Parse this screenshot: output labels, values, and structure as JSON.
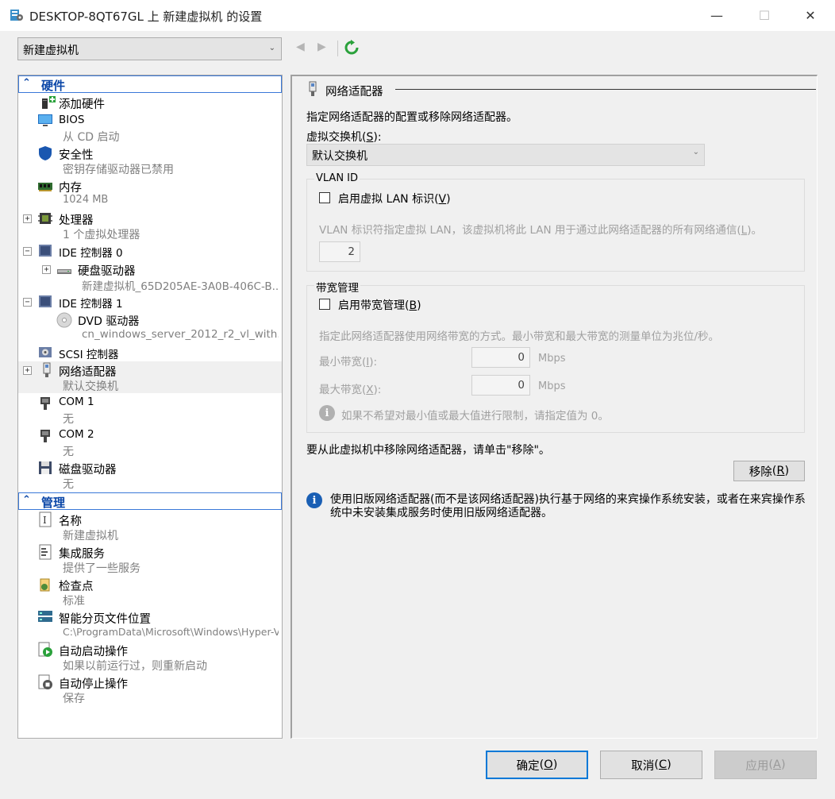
{
  "window": {
    "title": "DESKTOP-8QT67GL 上 新建虚拟机 的设置",
    "min_symbol": "—",
    "max_symbol": "☐",
    "close_symbol": "✕"
  },
  "vm_selector": {
    "value": "新建虚拟机",
    "caret": "⌄"
  },
  "nav": {
    "back_icon": "◀",
    "forward_icon": "▶"
  },
  "tree": {
    "hardware_header": "硬件",
    "management_header": "管理",
    "hardware": {
      "add_hardware": "添加硬件",
      "bios": "BIOS",
      "bios_sub": "从 CD 启动",
      "security": "安全性",
      "security_sub": "密钥存储驱动器已禁用",
      "memory": "内存",
      "memory_sub": "1024 MB",
      "processor": "处理器",
      "processor_sub": "1 个虚拟处理器",
      "ide0": "IDE 控制器 0",
      "hdd": "硬盘驱动器",
      "hdd_sub": "新建虚拟机_65D205AE-3A0B-406C-B...",
      "ide1": "IDE 控制器 1",
      "dvd": "DVD 驱动器",
      "dvd_sub": "cn_windows_server_2012_r2_vl_with...",
      "scsi": "SCSI 控制器",
      "nic": "网络适配器",
      "nic_sub": "默认交换机",
      "com1": "COM 1",
      "com1_sub": "无",
      "com2": "COM 2",
      "com2_sub": "无",
      "floppy": "磁盘驱动器",
      "floppy_sub": "无"
    },
    "management": {
      "name": "名称",
      "name_sub": "新建虚拟机",
      "integration": "集成服务",
      "integration_sub": "提供了一些服务",
      "checkpoint": "检查点",
      "checkpoint_sub": "标准",
      "paging": "智能分页文件位置",
      "paging_sub": "C:\\ProgramData\\Microsoft\\Windows\\Hyper-V",
      "autostart": "自动启动操作",
      "autostart_sub": "如果以前运行过，则重新启动",
      "autostop": "自动停止操作",
      "autostop_sub": "保存"
    }
  },
  "panel": {
    "heading": "网络适配器",
    "description": "指定网络适配器的配置或移除网络适配器。",
    "switch_label": "虚拟交换机",
    "switch_accel": "S",
    "switch_value": "默认交换机",
    "vlan_group": "VLAN ID",
    "vlan_checkbox": "启用虚拟 LAN 标识",
    "vlan_checkbox_accel": "V",
    "vlan_desc": "VLAN 标识符指定虚拟 LAN，该虚拟机将此 LAN 用于通过此网络适配器的所有网络通信(",
    "vlan_desc_accel": "L",
    "vlan_desc_end": ")。",
    "vlan_value": "2",
    "bw_group": "带宽管理",
    "bw_checkbox": "启用带宽管理",
    "bw_checkbox_accel": "B",
    "bw_desc": "指定此网络适配器使用网络带宽的方式。最小带宽和最大带宽的测量单位为兆位/秒。",
    "min_label": "最小带宽",
    "min_accel": "I",
    "min_value": "0",
    "max_label": "最大带宽",
    "max_accel": "X",
    "max_value": "0",
    "unit": "Mbps",
    "bw_hint": "如果不希望对最小值或最大值进行限制，请指定值为 0。",
    "remove_text": "要从此虚拟机中移除网络适配器，请单击\"移除\"。",
    "remove_button": "移除",
    "remove_accel": "R",
    "legacy_info": "使用旧版网络适配器(而不是该网络适配器)执行基于网络的来宾操作系统安装，或者在来宾操作系统中未安装集成服务时使用旧版网络适配器。"
  },
  "footer": {
    "ok": "确定",
    "ok_accel": "O",
    "cancel": "取消",
    "cancel_accel": "C",
    "apply": "应用",
    "apply_accel": "A"
  },
  "colors": {
    "accent": "#0078d7",
    "section_header": "#0b47a8",
    "gray_text": "#808080",
    "refresh_green": "#2aa13b"
  }
}
